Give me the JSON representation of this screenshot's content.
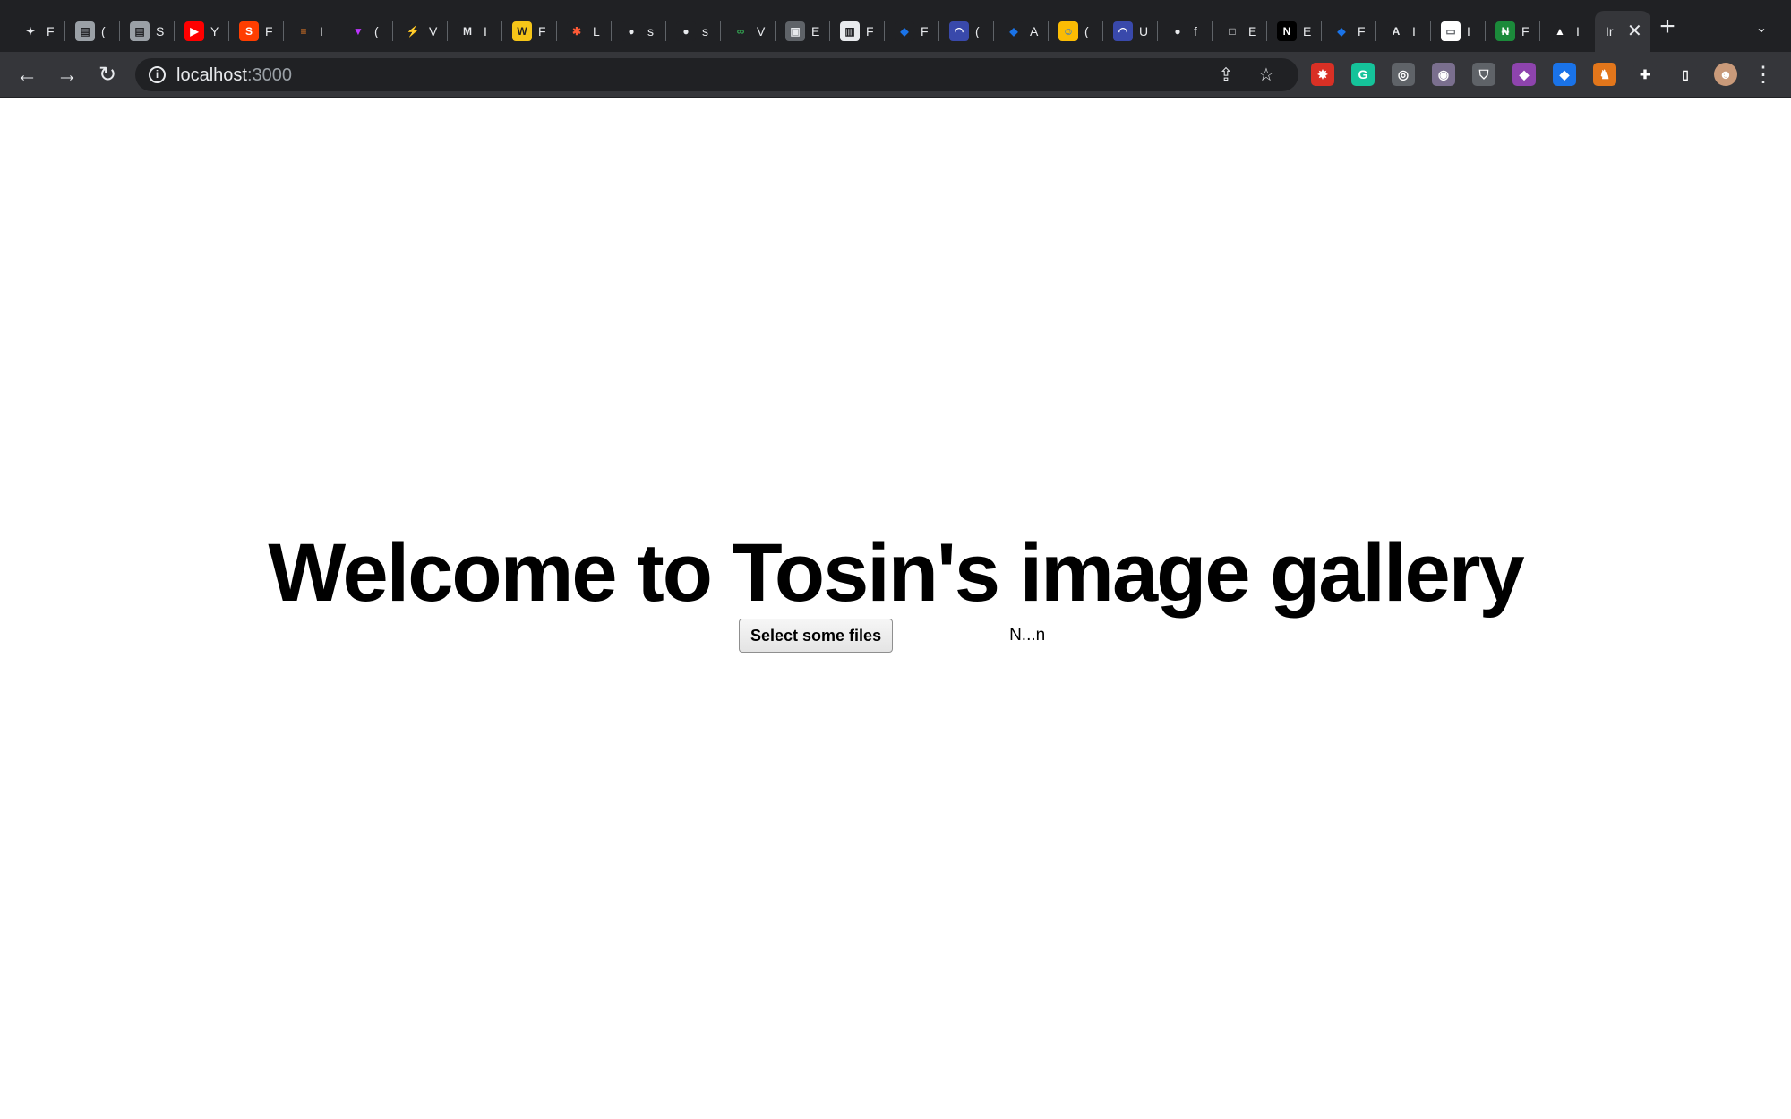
{
  "browser": {
    "tabs": [
      {
        "icon": "android-icon",
        "glyph": "✦",
        "bg": "#202124",
        "fg": "#e8eaed",
        "letter": "F"
      },
      {
        "icon": "book-icon",
        "glyph": "▤",
        "bg": "#9aa0a6",
        "fg": "#202124",
        "letter": "("
      },
      {
        "icon": "book-icon",
        "glyph": "▤",
        "bg": "#9aa0a6",
        "fg": "#202124",
        "letter": "S"
      },
      {
        "icon": "youtube-icon",
        "glyph": "▶",
        "bg": "#ff0000",
        "fg": "#ffffff",
        "letter": "Y"
      },
      {
        "icon": "svelte-icon",
        "glyph": "S",
        "bg": "#ff3e00",
        "fg": "#ffffff",
        "letter": "F"
      },
      {
        "icon": "stackoverflow-icon",
        "glyph": "≡",
        "bg": "#202124",
        "fg": "#f48024",
        "letter": "I"
      },
      {
        "icon": "vite-icon",
        "glyph": "▼",
        "bg": "#202124",
        "fg": "#bd34fe",
        "letter": "("
      },
      {
        "icon": "lightning-icon",
        "glyph": "⚡",
        "bg": "#202124",
        "fg": "#4a9eff",
        "letter": "V"
      },
      {
        "icon": "medium-icon",
        "glyph": "M",
        "bg": "#202124",
        "fg": "#e8eaed",
        "letter": "I"
      },
      {
        "icon": "wordwall-icon",
        "glyph": "W",
        "bg": "#f5c518",
        "fg": "#202124",
        "letter": "F"
      },
      {
        "icon": "asterisk-icon",
        "glyph": "✱",
        "bg": "#202124",
        "fg": "#ff5a36",
        "letter": "L"
      },
      {
        "icon": "github-icon",
        "glyph": "●",
        "bg": "#202124",
        "fg": "#e8eaed",
        "letter": "s"
      },
      {
        "icon": "github-icon",
        "glyph": "●",
        "bg": "#202124",
        "fg": "#e8eaed",
        "letter": "s"
      },
      {
        "icon": "link-icon",
        "glyph": "∞",
        "bg": "#202124",
        "fg": "#34a853",
        "letter": "V"
      },
      {
        "icon": "image-icon",
        "glyph": "▣",
        "bg": "#5f6368",
        "fg": "#e8eaed",
        "letter": "E"
      },
      {
        "icon": "trello-icon",
        "glyph": "▥",
        "bg": "#e8eaed",
        "fg": "#202124",
        "letter": "F"
      },
      {
        "icon": "layers-icon",
        "glyph": "◆",
        "bg": "#202124",
        "fg": "#1a73e8",
        "letter": "F"
      },
      {
        "icon": "dashboard-icon",
        "glyph": "◠",
        "bg": "#3949ab",
        "fg": "#ffffff",
        "letter": "("
      },
      {
        "icon": "layers-icon",
        "glyph": "◆",
        "bg": "#202124",
        "fg": "#1a73e8",
        "letter": "A"
      },
      {
        "icon": "smile-icon",
        "glyph": "☺",
        "bg": "#fbbc04",
        "fg": "#1a73e8",
        "letter": "("
      },
      {
        "icon": "dashboard-icon",
        "glyph": "◠",
        "bg": "#3949ab",
        "fg": "#ffffff",
        "letter": "U"
      },
      {
        "icon": "github-icon",
        "glyph": "●",
        "bg": "#202124",
        "fg": "#e8eaed",
        "letter": "f"
      },
      {
        "icon": "square-icon",
        "glyph": "□",
        "bg": "#202124",
        "fg": "#e8eaed",
        "letter": "E"
      },
      {
        "icon": "nextjs-icon",
        "glyph": "N",
        "bg": "#000000",
        "fg": "#ffffff",
        "letter": "E"
      },
      {
        "icon": "layers-icon",
        "glyph": "◆",
        "bg": "#202124",
        "fg": "#1a73e8",
        "letter": "F"
      },
      {
        "icon": "apollo-icon",
        "glyph": "A",
        "bg": "#202124",
        "fg": "#e8eaed",
        "letter": "I"
      },
      {
        "icon": "card-icon",
        "glyph": "▭",
        "bg": "#ffffff",
        "fg": "#5f6368",
        "letter": "I"
      },
      {
        "icon": "naira-icon",
        "glyph": "₦",
        "bg": "#1b8a3a",
        "fg": "#ffffff",
        "letter": "F"
      },
      {
        "icon": "vercel-icon",
        "glyph": "▲",
        "bg": "#202124",
        "fg": "#ffffff",
        "letter": "I"
      }
    ],
    "active_tab": {
      "label": "Ir"
    },
    "address": {
      "host": "localhost",
      "port": ":3000"
    }
  },
  "extensions": [
    {
      "icon": "puzzle-red-icon",
      "glyph": "✸",
      "bg": "#d93025"
    },
    {
      "icon": "grammarly-icon",
      "glyph": "G",
      "bg": "#15c39a"
    },
    {
      "icon": "target-icon",
      "glyph": "◎",
      "bg": "#5f6368"
    },
    {
      "icon": "bug-icon",
      "glyph": "◉",
      "bg": "#7a6f8e"
    },
    {
      "icon": "shield-icon",
      "glyph": "⛉",
      "bg": "#5f6368"
    },
    {
      "icon": "color-picker-icon",
      "glyph": "◆",
      "bg": "#8e44ad"
    },
    {
      "icon": "ethereum-icon",
      "glyph": "◆",
      "bg": "#1a73e8"
    },
    {
      "icon": "metamask-icon",
      "glyph": "♞",
      "bg": "#e2761b"
    },
    {
      "icon": "puzzle-icon",
      "glyph": "✚",
      "bg": "#35363a"
    },
    {
      "icon": "sidepanel-icon",
      "glyph": "▯",
      "bg": "#35363a"
    },
    {
      "icon": "profile-avatar",
      "glyph": "☻",
      "bg": "#c99a7a"
    }
  ],
  "page": {
    "title": "Welcome to Tosin's image gallery",
    "file_button_label": "Select some files",
    "file_status": "N...n"
  }
}
